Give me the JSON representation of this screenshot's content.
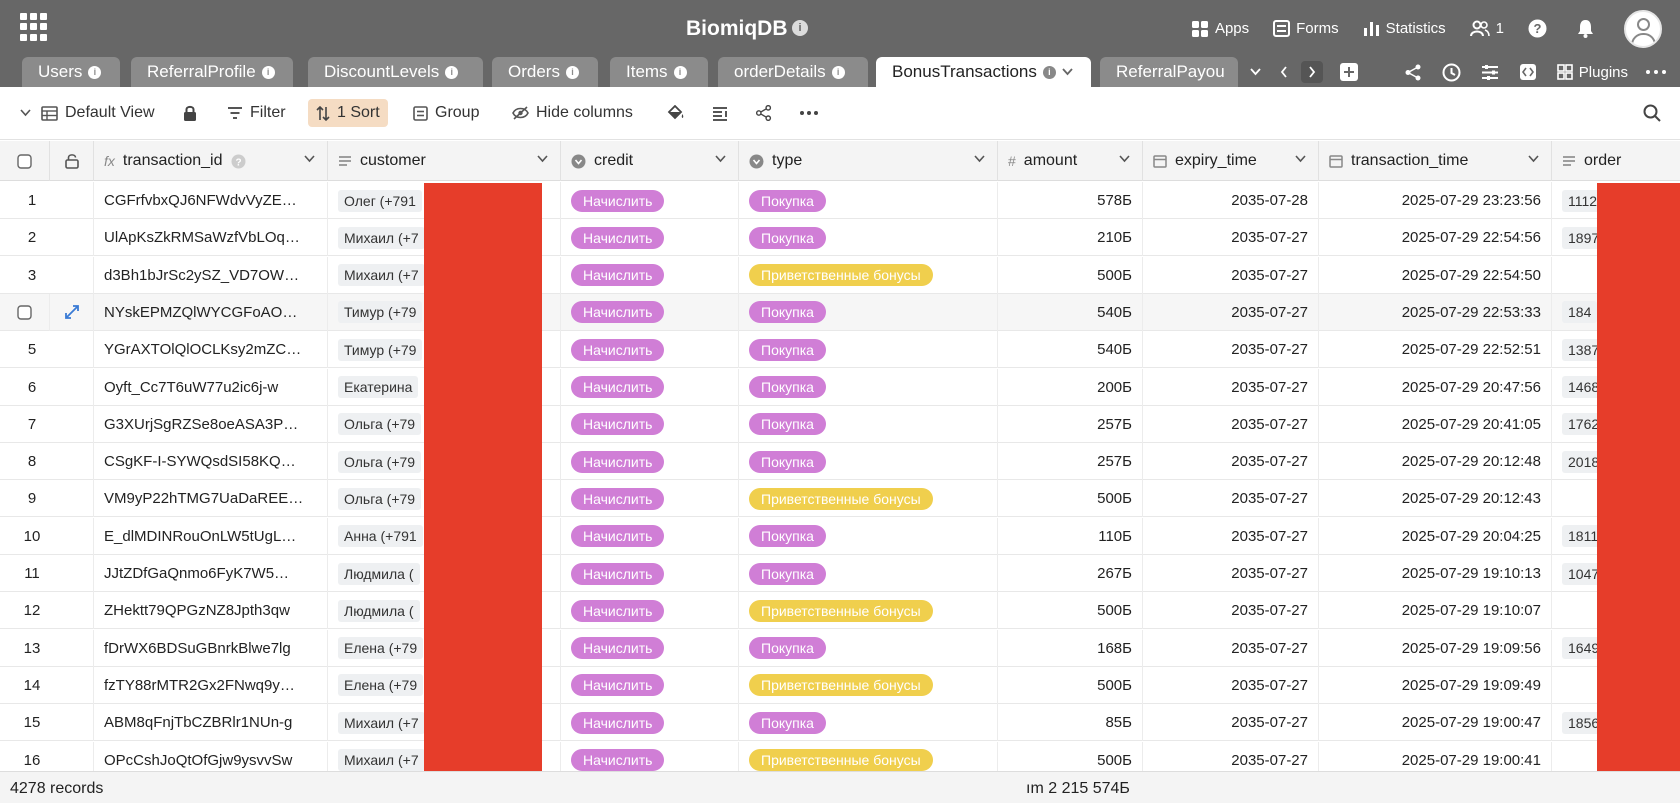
{
  "header": {
    "title": "BiomiqDB",
    "apps": "Apps",
    "forms": "Forms",
    "statistics": "Statistics",
    "collaborators": "1"
  },
  "tabs": [
    {
      "label": "Users"
    },
    {
      "label": "ReferralProfile"
    },
    {
      "label": "DiscountLevels"
    },
    {
      "label": "Orders"
    },
    {
      "label": "Items"
    },
    {
      "label": "orderDetails"
    },
    {
      "label": "BonusTransactions"
    },
    {
      "label": "ReferralPayou"
    }
  ],
  "tab_tools": {
    "plugins": "Plugins"
  },
  "toolbar": {
    "view": "Default View",
    "filter": "Filter",
    "sort": "1 Sort",
    "group": "Group",
    "hide_columns": "Hide columns"
  },
  "columns": {
    "transaction_id": "transaction_id",
    "customer": "customer",
    "credit": "credit",
    "type": "type",
    "amount": "amount",
    "expiry_time": "expiry_time",
    "transaction_time": "transaction_time",
    "order": "order"
  },
  "rows": [
    {
      "n": "1",
      "id": "CGFrfvbxQJ6NFWdvVyZE…",
      "customer": "Олег (+791",
      "credit": "Начислить",
      "type": "Покупка",
      "type_color": "purple",
      "amount": "578Б",
      "expiry": "2035-07-28",
      "time": "2025-07-29 23:23:56",
      "order": "1112"
    },
    {
      "n": "2",
      "id": "UlApKsZkRMSaWzfVbLOq…",
      "customer": "Михаил (+7",
      "credit": "Начислить",
      "type": "Покупка",
      "type_color": "purple",
      "amount": "210Б",
      "expiry": "2035-07-27",
      "time": "2025-07-29 22:54:56",
      "order": "1897"
    },
    {
      "n": "3",
      "id": "d3Bh1bJrSc2ySZ_VD7OW…",
      "customer": "Михаил (+7",
      "credit": "Начислить",
      "type": "Приветственные бонусы",
      "type_color": "yellow",
      "amount": "500Б",
      "expiry": "2035-07-27",
      "time": "2025-07-29 22:54:50",
      "order": ""
    },
    {
      "n": "",
      "id": "NYskEPMZQlWYCGFoAO…",
      "customer": "Тимур (+79",
      "credit": "Начислить",
      "type": "Покупка",
      "type_color": "purple",
      "amount": "540Б",
      "expiry": "2035-07-27",
      "time": "2025-07-29 22:53:33",
      "order": "184"
    },
    {
      "n": "5",
      "id": "YGrAXTOlQlOCLKsy2mZC…",
      "customer": "Тимур (+79",
      "credit": "Начислить",
      "type": "Покупка",
      "type_color": "purple",
      "amount": "540Б",
      "expiry": "2035-07-27",
      "time": "2025-07-29 22:52:51",
      "order": "1387"
    },
    {
      "n": "6",
      "id": "Oyft_Cc7T6uW77u2ic6j-w",
      "customer": "Екатерина",
      "credit": "Начислить",
      "type": "Покупка",
      "type_color": "purple",
      "amount": "200Б",
      "expiry": "2035-07-27",
      "time": "2025-07-29 20:47:56",
      "order": "1468"
    },
    {
      "n": "7",
      "id": "G3XUrjSgRZSe8oeASA3P…",
      "customer": "Ольга (+79",
      "credit": "Начислить",
      "type": "Покупка",
      "type_color": "purple",
      "amount": "257Б",
      "expiry": "2035-07-27",
      "time": "2025-07-29 20:41:05",
      "order": "1762"
    },
    {
      "n": "8",
      "id": "CSgKF-I-SYWQsdSI58KQ…",
      "customer": "Ольга (+79",
      "credit": "Начислить",
      "type": "Покупка",
      "type_color": "purple",
      "amount": "257Б",
      "expiry": "2035-07-27",
      "time": "2025-07-29 20:12:48",
      "order": "2018"
    },
    {
      "n": "9",
      "id": "VM9yP22hTMG7UaDaREE…",
      "customer": "Ольга (+79",
      "credit": "Начислить",
      "type": "Приветственные бонусы",
      "type_color": "yellow",
      "amount": "500Б",
      "expiry": "2035-07-27",
      "time": "2025-07-29 20:12:43",
      "order": ""
    },
    {
      "n": "10",
      "id": "E_dlMDINRouOnLW5tUgL…",
      "customer": "Анна (+791",
      "credit": "Начислить",
      "type": "Покупка",
      "type_color": "purple",
      "amount": "110Б",
      "expiry": "2035-07-27",
      "time": "2025-07-29 20:04:25",
      "order": "1811"
    },
    {
      "n": "11",
      "id": "JJtZDfGaQnmo6FyK7W5…",
      "customer": "Людмила (",
      "credit": "Начислить",
      "type": "Покупка",
      "type_color": "purple",
      "amount": "267Б",
      "expiry": "2035-07-27",
      "time": "2025-07-29 19:10:13",
      "order": "1047"
    },
    {
      "n": "12",
      "id": "ZHektt79QPGzNZ8Jpth3qw",
      "customer": "Людмила (",
      "credit": "Начислить",
      "type": "Приветственные бонусы",
      "type_color": "yellow",
      "amount": "500Б",
      "expiry": "2035-07-27",
      "time": "2025-07-29 19:10:07",
      "order": ""
    },
    {
      "n": "13",
      "id": "fDrWX6BDSuGBnrkBlwe7lg",
      "customer": "Елена (+79",
      "credit": "Начислить",
      "type": "Покупка",
      "type_color": "purple",
      "amount": "168Б",
      "expiry": "2035-07-27",
      "time": "2025-07-29 19:09:56",
      "order": "1649"
    },
    {
      "n": "14",
      "id": "fzTY88rMTR2Gx2FNwq9y…",
      "customer": "Елена (+79",
      "credit": "Начислить",
      "type": "Приветственные бонусы",
      "type_color": "yellow",
      "amount": "500Б",
      "expiry": "2035-07-27",
      "time": "2025-07-29 19:09:49",
      "order": ""
    },
    {
      "n": "15",
      "id": "ABM8qFnjTbCZBRlr1NUn-g",
      "customer": "Михаил (+7",
      "credit": "Начислить",
      "type": "Покупка",
      "type_color": "purple",
      "amount": "85Б",
      "expiry": "2035-07-27",
      "time": "2025-07-29 19:00:47",
      "order": "1856"
    },
    {
      "n": "16",
      "id": "OPcCshJoQtOfGjw9ysvvSw",
      "customer": "Михаил (+7",
      "credit": "Начислить",
      "type": "Приветственные бонусы",
      "type_color": "yellow",
      "amount": "500Б",
      "expiry": "2035-07-27",
      "time": "2025-07-29 19:00:41",
      "order": ""
    }
  ],
  "footer": {
    "records": "4278 records",
    "sum": "ım 2 215 574Б"
  },
  "colors": {
    "header_bg": "#676767",
    "tab_bg": "#8b8b8b",
    "sort_active": "#f5dcc3",
    "pill_purple": "#d07ed6",
    "pill_yellow": "#f0cf4d",
    "redaction": "#e63d2a"
  }
}
